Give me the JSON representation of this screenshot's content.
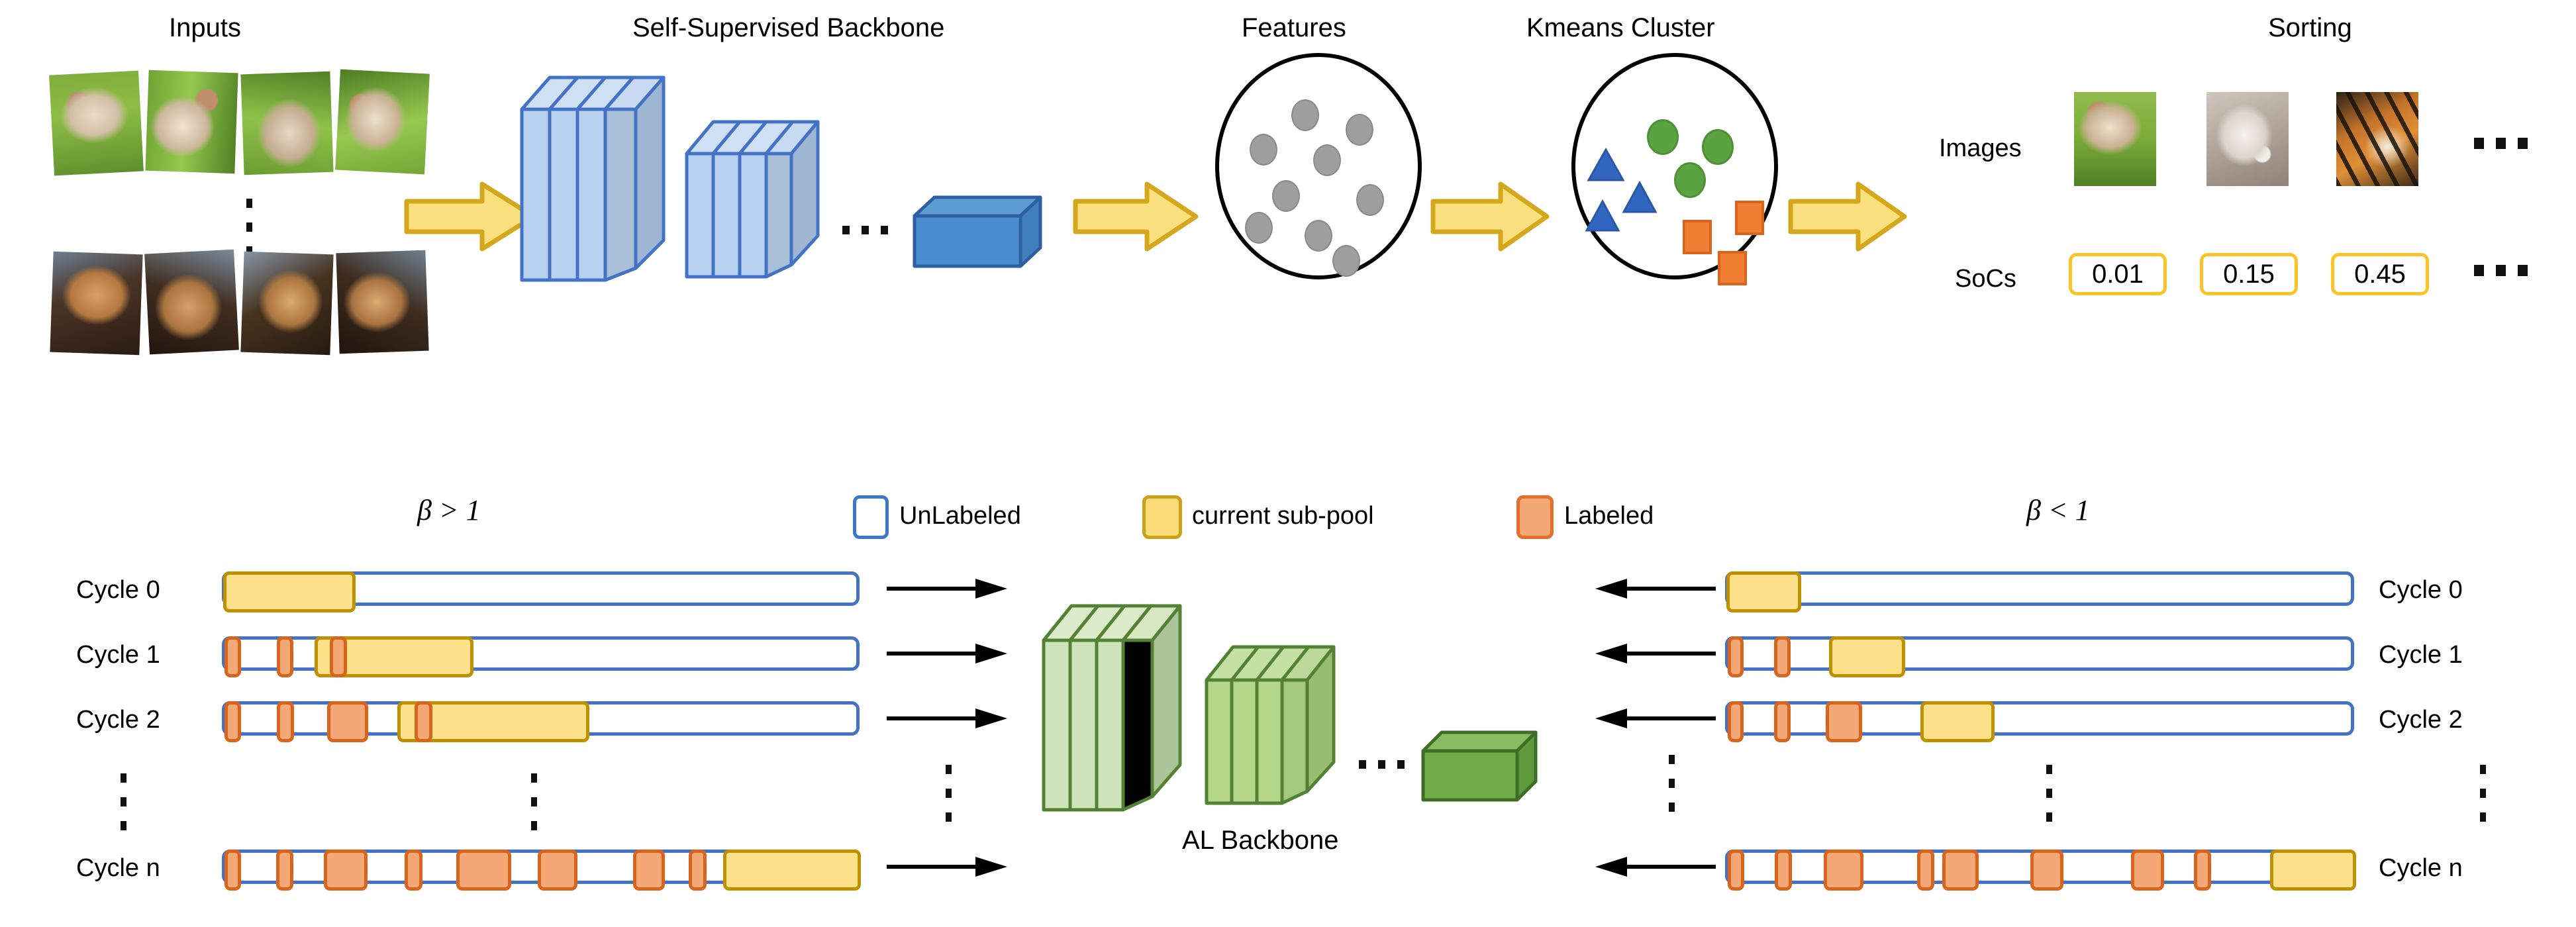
{
  "figure": {
    "top_pipeline": {
      "stage_titles": {
        "inputs": "Inputs",
        "backbone": "Self-Supervised Backbone",
        "features": "Features",
        "kmeans": "Kmeans Cluster",
        "sorting": "Sorting"
      },
      "inputs": {
        "row_top_count": 4,
        "row_bottom_count": 4,
        "vertical_ellipsis": "⋮"
      },
      "backbone": {
        "group1_slabs": 3,
        "group2_slabs": 3,
        "ellipsis": "...",
        "final_block_label": ""
      },
      "features": {
        "point_count": 9,
        "point_color": "#9e9e9e",
        "shape": "circle"
      },
      "kmeans": {
        "clusters": [
          {
            "name": "green-circles",
            "shape": "circle",
            "color": "#5aa340",
            "count": 3
          },
          {
            "name": "blue-triangles",
            "shape": "triangle",
            "color": "#2f5fc0",
            "count": 3
          },
          {
            "name": "orange-squares",
            "shape": "square",
            "color": "#ef8033",
            "count": 3
          }
        ]
      },
      "sorting": {
        "row_labels": {
          "images": "Images",
          "socs": "SoCs"
        },
        "soc_values": [
          "0.01",
          "0.15",
          "0.45"
        ],
        "image_count": 3,
        "ellipsis": "..."
      },
      "arrow_icon": "block-arrow-right",
      "arrow_color": "#f7d96b"
    },
    "bottom_pipeline": {
      "left_condition": "β > 1",
      "right_condition": "β < 1",
      "legend": [
        {
          "label": "UnLabeled",
          "fill": "#ffffff",
          "stroke": "#3c78c8"
        },
        {
          "label": "current sub-pool",
          "fill": "#fcdc78",
          "stroke": "#c9a21a"
        },
        {
          "label": "Labeled",
          "fill": "#f3a876",
          "stroke": "#e2712c"
        }
      ],
      "center_model": {
        "title": "AL Backbone",
        "group1_slabs": 3,
        "group2_slabs": 3,
        "ellipsis": "...",
        "color": "#70ad47"
      },
      "left_rows": [
        {
          "label": "Cycle 0",
          "labeled": [],
          "subpool": {
            "start": 0.0,
            "width": 0.205
          }
        },
        {
          "label": "Cycle 1",
          "labeled": [
            {
              "start": 0.003,
              "width": 0.025
            },
            {
              "start": 0.082,
              "width": 0.025
            },
            {
              "start": 0.165,
              "width": 0.026
            }
          ],
          "subpool": {
            "start": 0.143,
            "width": 0.247
          }
        },
        {
          "label": "Cycle 2",
          "labeled": [
            {
              "start": 0.003,
              "width": 0.026
            },
            {
              "start": 0.083,
              "width": 0.026
            },
            {
              "start": 0.16,
              "width": 0.064
            },
            {
              "start": 0.298,
              "width": 0.027
            }
          ],
          "subpool": {
            "start": 0.272,
            "width": 0.3
          }
        },
        {
          "label": "Cycle n",
          "labeled": [
            {
              "start": 0.003,
              "width": 0.026
            },
            {
              "start": 0.082,
              "width": 0.027
            },
            {
              "start": 0.155,
              "width": 0.068
            },
            {
              "start": 0.282,
              "width": 0.028
            },
            {
              "start": 0.363,
              "width": 0.086
            },
            {
              "start": 0.49,
              "width": 0.062
            },
            {
              "start": 0.64,
              "width": 0.05
            },
            {
              "start": 0.727,
              "width": 0.028
            }
          ],
          "subpool": {
            "start": 0.782,
            "width": 0.215
          }
        }
      ],
      "right_rows": [
        {
          "label": "Cycle 0",
          "labeled": [],
          "subpool": {
            "start": 0.0,
            "width": 0.118
          }
        },
        {
          "label": "Cycle 1",
          "labeled": [
            {
              "start": 0.003,
              "width": 0.024
            },
            {
              "start": 0.073,
              "width": 0.025
            }
          ],
          "subpool": {
            "start": 0.16,
            "width": 0.12
          }
        },
        {
          "label": "Cycle 2",
          "labeled": [
            {
              "start": 0.003,
              "width": 0.024
            },
            {
              "start": 0.073,
              "width": 0.025
            },
            {
              "start": 0.155,
              "width": 0.057
            }
          ],
          "subpool": {
            "start": 0.305,
            "width": 0.118
          }
        },
        {
          "label": "Cycle n",
          "labeled": [
            {
              "start": 0.003,
              "width": 0.025
            },
            {
              "start": 0.074,
              "width": 0.026
            },
            {
              "start": 0.152,
              "width": 0.063
            },
            {
              "start": 0.3,
              "width": 0.026
            },
            {
              "start": 0.34,
              "width": 0.057
            },
            {
              "start": 0.48,
              "width": 0.052
            },
            {
              "start": 0.64,
              "width": 0.052
            },
            {
              "start": 0.74,
              "width": 0.026
            }
          ],
          "subpool": {
            "start": 0.862,
            "width": 0.135
          }
        }
      ],
      "left_arrow_icon": "arrow-right",
      "right_arrow_icon": "arrow-left",
      "row_ellipsis": "⋮"
    }
  }
}
